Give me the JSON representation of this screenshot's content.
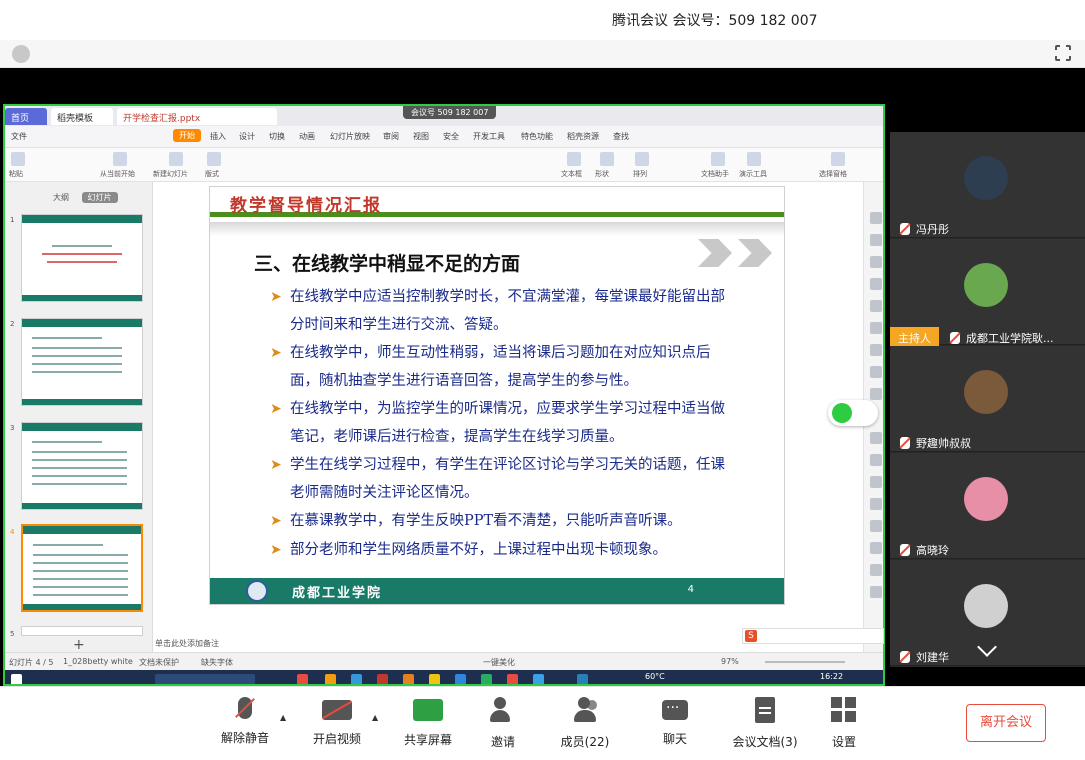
{
  "meeting": {
    "title": "腾讯会议 会议号：509 182 007",
    "pill": "会议号 509 182 007"
  },
  "wps": {
    "tabs": {
      "home": "首页",
      "t1": "稻壳模板",
      "t2": "开学检查汇报.pptx"
    },
    "menus": [
      "文件",
      "开始",
      "插入",
      "设计",
      "切换",
      "动画",
      "幻灯片放映",
      "审阅",
      "视图",
      "安全",
      "开发工具",
      "特色功能",
      "稻壳资源",
      "查找"
    ],
    "ribbon_labels": [
      "粘贴",
      "从当前开始",
      "新建幻灯片",
      "版式",
      "文本框",
      "形状",
      "排列",
      "文档助手",
      "演示工具",
      "选择窗格"
    ],
    "left_pane": {
      "outline": "大纲",
      "slides": "幻灯片"
    },
    "notes": "单击此处添加备注",
    "status": {
      "slide_count": "幻灯片 4 / 5",
      "theme": "1_028betty white",
      "protect": "文档未保护",
      "font": "缺失字体",
      "beautify": "一键美化",
      "zoom": "97%"
    },
    "clock": "16:22",
    "temp": "60°C"
  },
  "slide": {
    "header": "教学督导情况汇报",
    "heading": "三、在线教学中稍显不足的方面",
    "bullets": [
      "在线教学中应适当控制教学时长，不宜满堂灌，每堂课最好能留出部分时间来和学生进行交流、答疑。",
      "在线教学中，师生互动性稍弱，适当将课后习题加在对应知识点后面，随机抽查学生进行语音回答，提高学生的参与性。",
      "在线教学中，为监控学生的听课情况，应要求学生学习过程中适当做笔记，老师课后进行检查，提高学生在线学习质量。",
      "学生在线学习过程中，有学生在评论区讨论与学习无关的话题，任课老师需随时关注评论区情况。",
      "在慕课教学中，有学生反映PPT看不清楚，只能听声音听课。",
      "部分老师和学生网络质量不好，上课过程中出现卡顿现象。"
    ],
    "footer_school": "成都工业学院",
    "page_number": "4"
  },
  "participants": [
    {
      "name": "冯丹彤",
      "avatar_color": "#2c3e50"
    },
    {
      "name": "成都工业学院耿...",
      "host_badge": "主持人",
      "avatar_color": "#6aa84f"
    },
    {
      "name": "野趣帅叔叔",
      "avatar_color": "#7a5a3a"
    },
    {
      "name": "高晓玲",
      "avatar_color": "#e88fa8"
    },
    {
      "name": "刘建华",
      "avatar_color": "#d0d0d0"
    }
  ],
  "toolbar": {
    "unmute": "解除静音",
    "video": "开启视频",
    "share": "共享屏幕",
    "invite": "邀请",
    "members": "成员(22)",
    "chat": "聊天",
    "docs": "会议文档(3)",
    "settings": "设置",
    "leave": "离开会议"
  }
}
